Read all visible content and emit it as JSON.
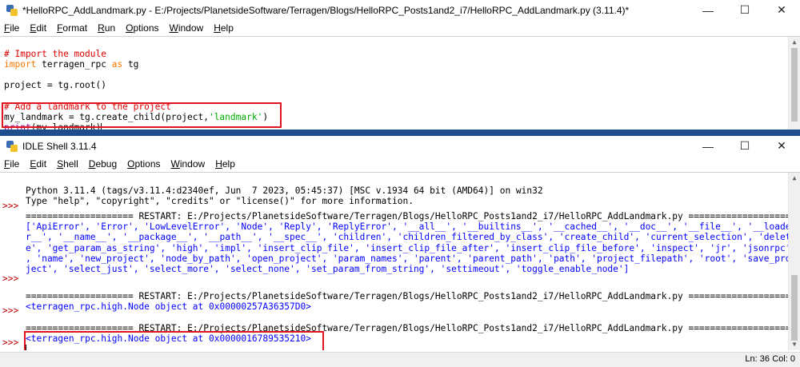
{
  "editor_window": {
    "title": "*HelloRPC_AddLandmark.py - E:/Projects/PlanetsideSoftware/Terragen/Blogs/HelloRPC_Posts1and2_i7/HelloRPC_AddLandmark.py (3.11.4)*",
    "menu": [
      "File",
      "Edit",
      "Format",
      "Run",
      "Options",
      "Window",
      "Help"
    ],
    "controls": {
      "minimize": "—",
      "maximize": "☐",
      "close": "✕"
    },
    "code": {
      "line1": "# Import the module",
      "line2_kw": "import",
      "line2_rest": " terragen_rpc ",
      "line2_as": "as",
      "line2_end": " tg",
      "line4": "project = tg.root()",
      "line6": "# Add a landmark to the project",
      "line7_a": "my_landmark = tg.create_child(project,",
      "line7_str": "'landmark'",
      "line7_b": ")",
      "line8_bi": "print",
      "line8_rest": "(my_landmark)"
    }
  },
  "shell_window": {
    "title": "IDLE Shell 3.11.4",
    "menu": [
      "File",
      "Edit",
      "Shell",
      "Debug",
      "Options",
      "Window",
      "Help"
    ],
    "controls": {
      "minimize": "—",
      "maximize": "☐",
      "close": "✕"
    },
    "prompt": ">>>",
    "lines": {
      "banner1": "Python 3.11.4 (tags/v3.11.4:d2340ef, Jun  7 2023, 05:45:37) [MSC v.1934 64 bit (AMD64)] on win32",
      "banner2": "Type \"help\", \"copyright\", \"credits\" or \"license()\" for more information.",
      "restart1": "==================== RESTART: E:/Projects/PlanetsideSoftware/Terragen/Blogs/HelloRPC_Posts1and2_i7/HelloRPC_AddLandmark.py ====================",
      "out1": "['ApiError', 'Error', 'LowLevelError', 'Node', 'Reply', 'ReplyError', '__all__', '__builtins__', '__cached__', '__doc__', '__file__', '__loade",
      "out2": "r__', '__name__', '__package__', '__path__', '__spec__', 'children', 'children_filtered_by_class', 'create_child', 'current_selection', 'delet",
      "out3": "e', 'get_param_as_string', 'high', 'impl', 'insert_clip_file', 'insert_clip_file_after', 'insert_clip_file_before', 'inspect', 'jr', 'jsonrpc'",
      "out4": ", 'name', 'new_project', 'node_by_path', 'open_project', 'param_names', 'parent', 'parent_path', 'path', 'project_filepath', 'root', 'save_pro",
      "out5": "ject', 'select_just', 'select_more', 'select_none', 'set_param_from_string', 'settimeout', 'toggle_enable_node']",
      "restart2": "==================== RESTART: E:/Projects/PlanetsideSoftware/Terragen/Blogs/HelloRPC_Posts1and2_i7/HelloRPC_AddLandmark.py ====================",
      "node1": "<terragen_rpc.high.Node object at 0x00000257A36357D0>",
      "restart3": "==================== RESTART: E:/Projects/PlanetsideSoftware/Terragen/Blogs/HelloRPC_Posts1and2_i7/HelloRPC_AddLandmark.py ====================",
      "node2": "<terragen_rpc.high.Node object at 0x0000016789535210>"
    },
    "status": {
      "ln": "Ln: 36",
      "col": "Col: 0"
    }
  },
  "colors": {
    "highlight_box": "#e0141e",
    "comment": "#dd0000",
    "keyword": "#ff7700",
    "string": "#00aa00",
    "builtin": "#900090",
    "output": "#0000ff",
    "desktop": "#1e4f8c"
  }
}
